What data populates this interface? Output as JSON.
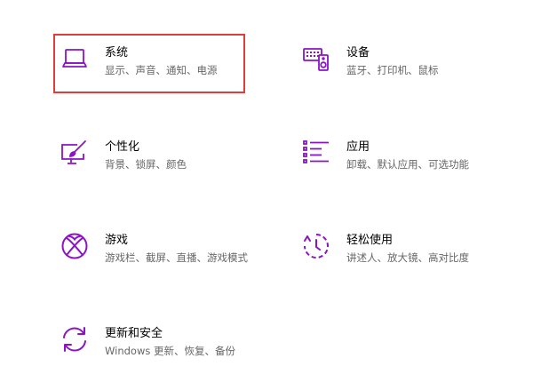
{
  "window": {
    "title": ""
  },
  "accent_color": "#8a14c6",
  "selection_color": "#e03c3c",
  "tiles": [
    {
      "id": "system",
      "icon": "laptop-icon",
      "title": "系统",
      "description": "显示、声音、通知、电源",
      "selected": true
    },
    {
      "id": "devices",
      "icon": "keyboard-speaker-icon",
      "title": "设备",
      "description": "蓝牙、打印机、鼠标",
      "selected": false
    },
    {
      "id": "personalization",
      "icon": "paint-brush-icon",
      "title": "个性化",
      "description": "背景、锁屏、颜色",
      "selected": false
    },
    {
      "id": "apps",
      "icon": "apps-list-icon",
      "title": "应用",
      "description": "卸载、默认应用、可选功能",
      "selected": false
    },
    {
      "id": "gaming",
      "icon": "xbox-icon",
      "title": "游戏",
      "description": "游戏栏、截屏、直播、游戏模式",
      "selected": false
    },
    {
      "id": "accessibility",
      "icon": "ease-of-access-icon",
      "title": "轻松使用",
      "description": "讲述人、放大镜、高对比度",
      "selected": false
    },
    {
      "id": "update",
      "icon": "sync-icon",
      "title": "更新和安全",
      "description": "Windows 更新、恢复、备份",
      "selected": false
    }
  ]
}
